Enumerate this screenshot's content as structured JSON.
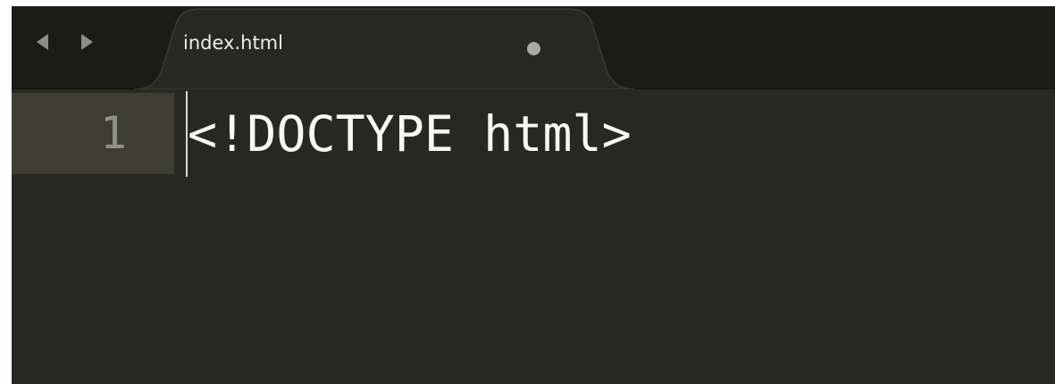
{
  "navigation": {
    "back_icon": "triangle-left-icon",
    "forward_icon": "triangle-right-icon"
  },
  "tabs": [
    {
      "label": "index.html",
      "active": true,
      "modified": true
    }
  ],
  "editor": {
    "lines": [
      {
        "number": "1",
        "text": "<!DOCTYPE html>",
        "current": true
      }
    ]
  },
  "colors": {
    "tabbar_background": "#1b1b18",
    "editor_background": "#272822",
    "active_line_gutter": "#3e3d32",
    "text": "#f8f8f2",
    "line_number": "#8f908a"
  }
}
